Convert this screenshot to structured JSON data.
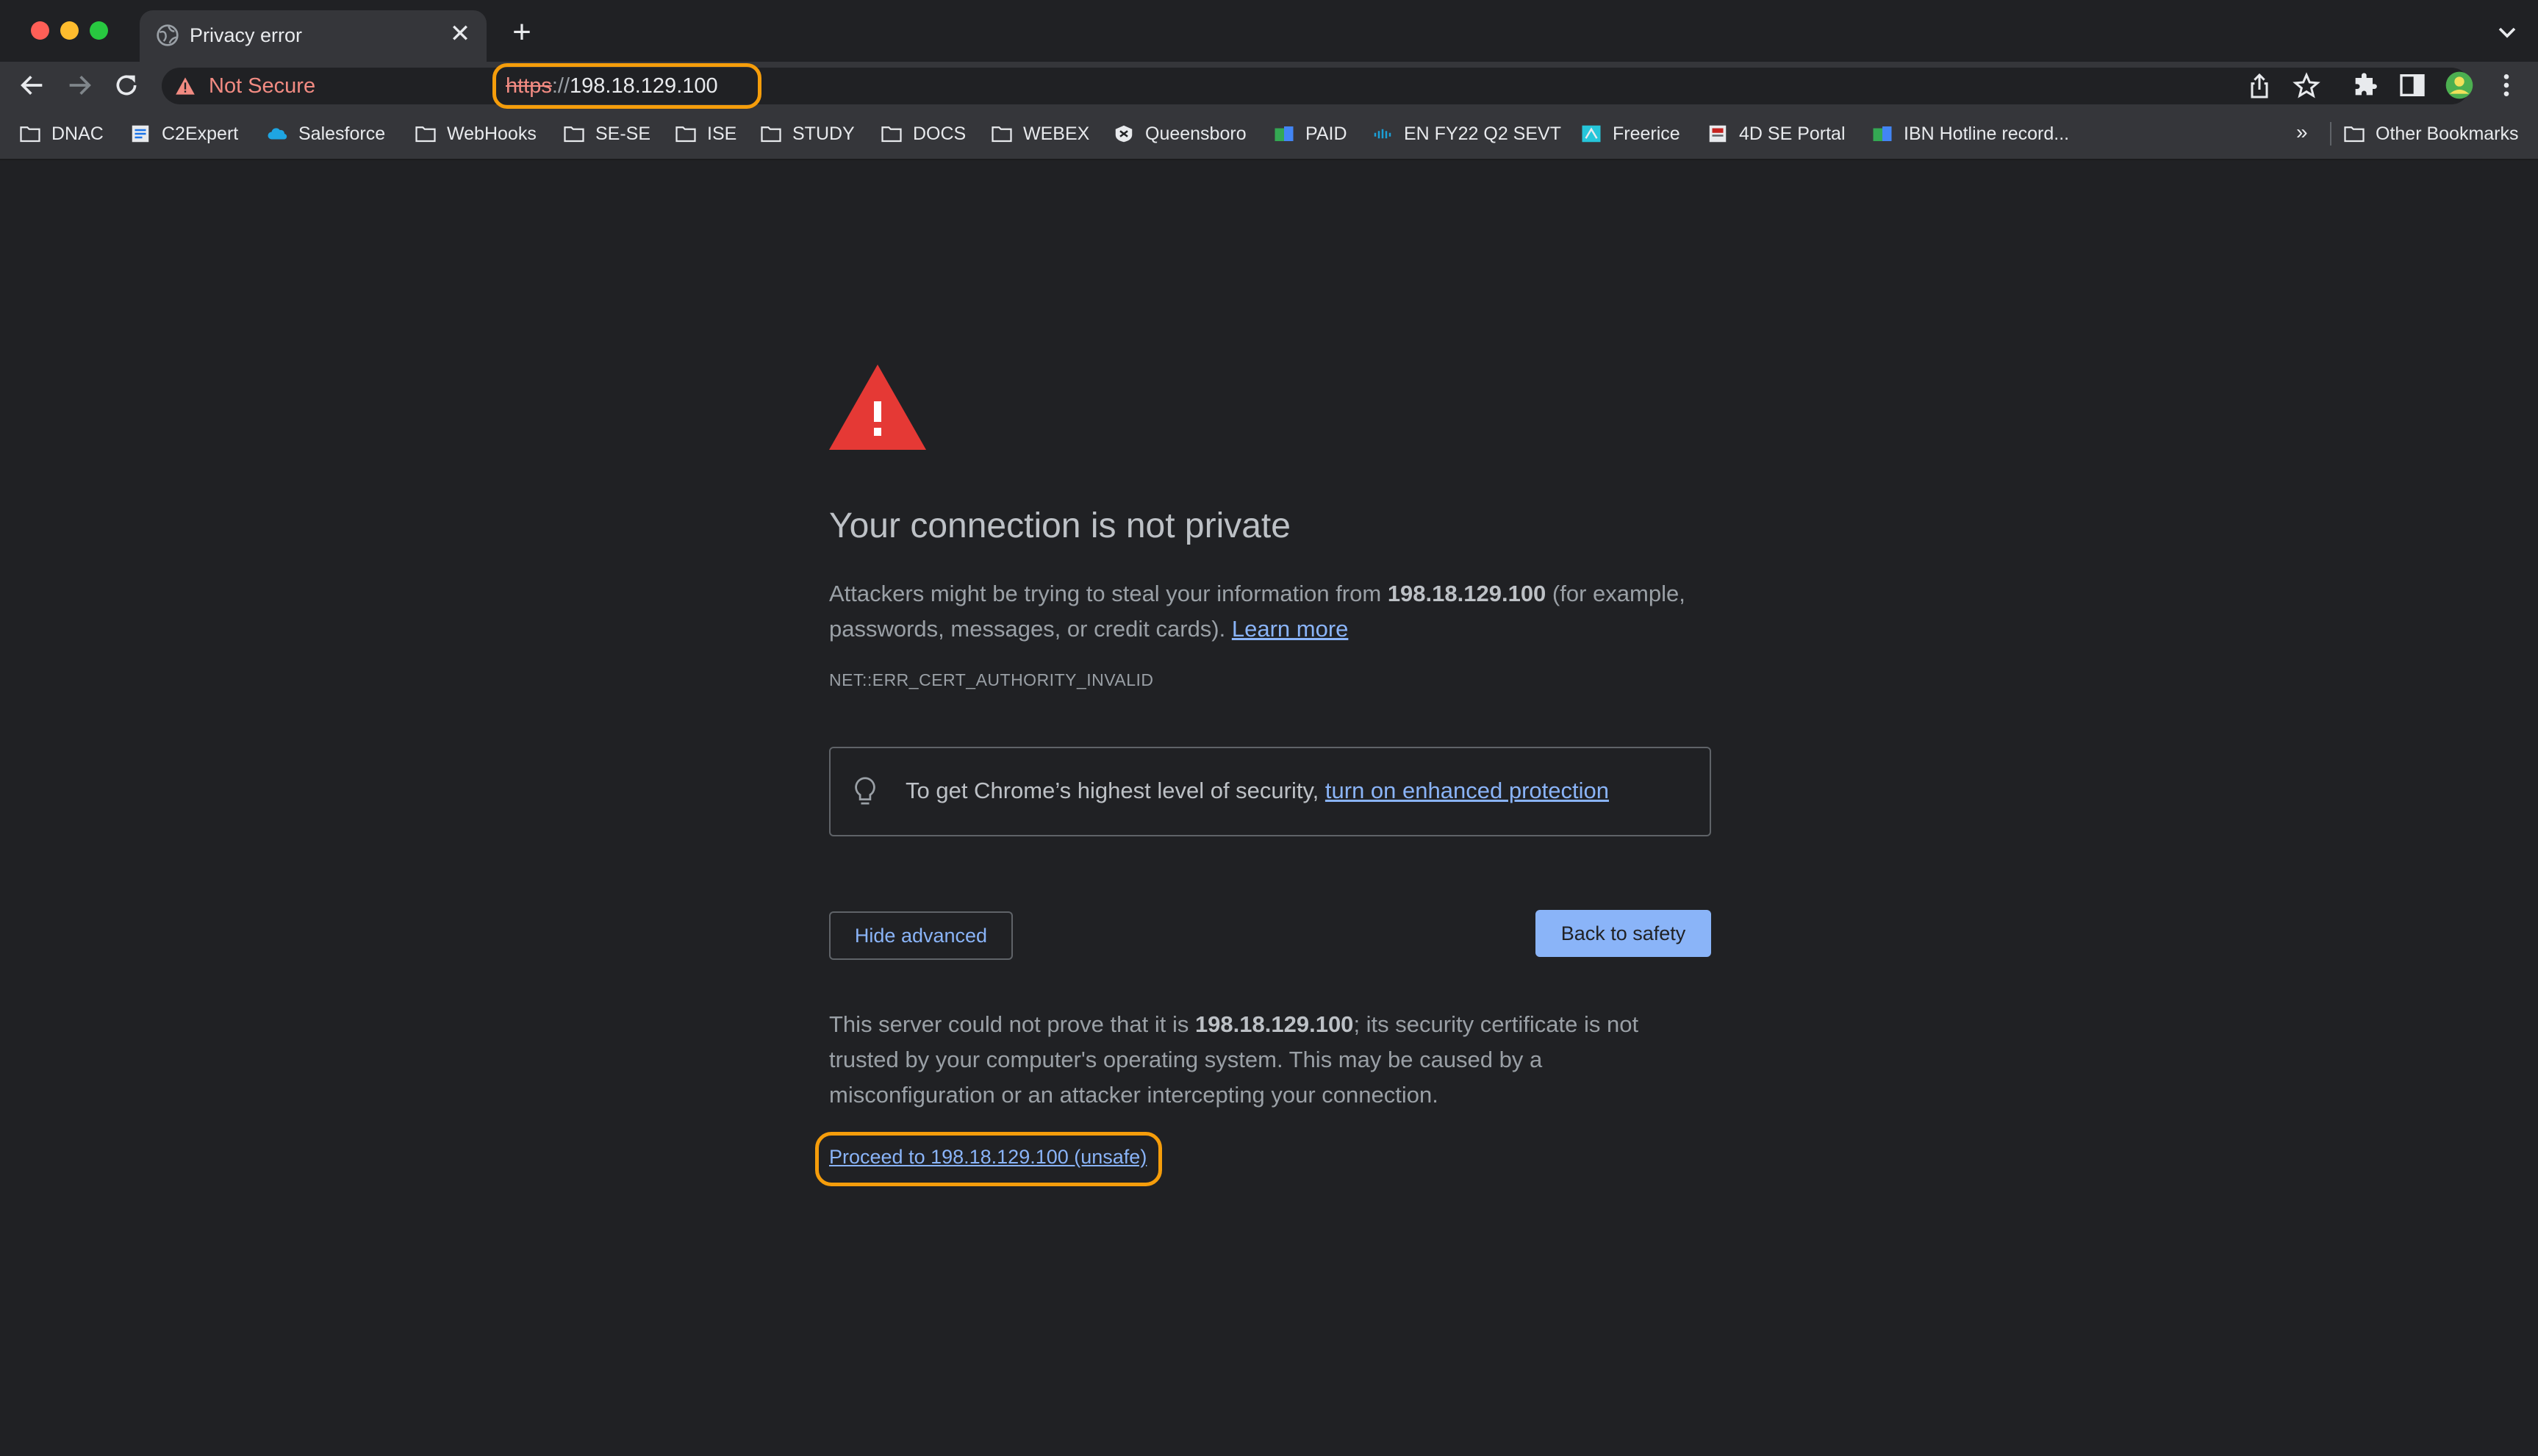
{
  "tab": {
    "title": "Privacy error",
    "close_glyph": "✕",
    "new_tab_glyph": "+"
  },
  "toolbar": {
    "not_secure_label": "Not Secure",
    "url_scheme": "https",
    "url_separator": "://",
    "url_host": "198.18.129.100"
  },
  "bookmarks": {
    "items": [
      {
        "label": "DNAC",
        "icon": "folder-icon"
      },
      {
        "label": "C2Expert",
        "icon": "site-favicon"
      },
      {
        "label": "Salesforce",
        "icon": "salesforce-cloud-icon"
      },
      {
        "label": "WebHooks",
        "icon": "folder-icon"
      },
      {
        "label": "SE-SE",
        "icon": "folder-icon"
      },
      {
        "label": "ISE",
        "icon": "folder-icon"
      },
      {
        "label": "STUDY",
        "icon": "folder-icon"
      },
      {
        "label": "DOCS",
        "icon": "folder-icon"
      },
      {
        "label": "WEBEX",
        "icon": "folder-icon"
      },
      {
        "label": "Queensboro",
        "icon": "site-favicon"
      },
      {
        "label": "PAID",
        "icon": "site-favicon"
      },
      {
        "label": "EN FY22 Q2 SEVT",
        "icon": "cisco-icon"
      },
      {
        "label": "Freerice",
        "icon": "site-favicon"
      },
      {
        "label": "4D SE Portal",
        "icon": "site-favicon"
      },
      {
        "label": "IBN Hotline record...",
        "icon": "site-favicon"
      }
    ],
    "overflow_glyph": "»",
    "other_bookmarks": "Other Bookmarks"
  },
  "interstitial": {
    "heading": "Your connection is not private",
    "explain_before": "Attackers might be trying to steal your information from ",
    "explain_host": "198.18.129.100",
    "explain_after": " (for example, passwords, messages, or credit cards). ",
    "learn_more": "Learn more",
    "error_code": "NET::ERR_CERT_AUTHORITY_INVALID",
    "enhanced_text": "To get Chrome’s highest level of security, ",
    "enhanced_link": "turn on enhanced protection",
    "hide_advanced": "Hide advanced",
    "back_to_safety": "Back to safety",
    "details_before": "This server could not prove that it is ",
    "details_host": "198.18.129.100",
    "details_after": "; its security certificate is not trusted by your computer's operating system. This may be caused by a misconfiguration or an attacker intercepting your connection.",
    "proceed_link": "Proceed to 198.18.129.100 (unsafe)"
  },
  "colors": {
    "background": "#202124",
    "toolbar": "#35363a",
    "link": "#8ab4f8",
    "warning_red": "#f28b82",
    "annotation_orange": "#f59d0b"
  }
}
